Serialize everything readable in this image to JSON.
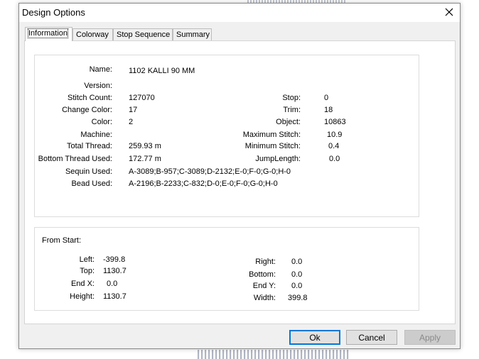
{
  "window": {
    "title": "Design Options"
  },
  "tabs": [
    {
      "label": "Information"
    },
    {
      "label": "Colorway"
    },
    {
      "label": "Stop Sequence"
    },
    {
      "label": "Summary"
    }
  ],
  "info": {
    "name_label": "Name:",
    "name_value": "1102 KALLI 90 MM",
    "version_label": "Version:",
    "version_value": "",
    "stitch_count_label": "Stitch Count:",
    "stitch_count_value": "127070",
    "change_color_label": "Change Color:",
    "change_color_value": "17",
    "color_label": "Color:",
    "color_value": "2",
    "machine_label": "Machine:",
    "machine_value": "",
    "total_thread_label": "Total Thread:",
    "total_thread_value": "259.93 m",
    "bottom_thread_label": "Bottom Thread Used:",
    "bottom_thread_value": "172.77 m",
    "sequin_label": "Sequin Used:",
    "sequin_value": "A-3089;B-957;C-3089;D-2132;E-0;F-0;G-0;H-0",
    "bead_label": "Bead Used:",
    "bead_value": "A-2196;B-2233;C-832;D-0;E-0;F-0;G-0;H-0",
    "stop_label": "Stop:",
    "stop_value": "0",
    "trim_label": "Trim:",
    "trim_value": "18",
    "object_label": "Object:",
    "object_value": "10863",
    "max_stitch_label": "Maximum Stitch:",
    "max_stitch_value": "10.9",
    "min_stitch_label": "Minimum Stitch:",
    "min_stitch_value": "0.4",
    "jump_length_label": "JumpLength:",
    "jump_length_value": "0.0"
  },
  "from_start": {
    "header": "From Start:",
    "left_label": "Left:",
    "left_value": "-399.8",
    "top_label": "Top:",
    "top_value": "1130.7",
    "endx_label": "End X:",
    "endx_value": "0.0",
    "height_label": "Height:",
    "height_value": "1130.7",
    "right_label": "Right:",
    "right_value": "0.0",
    "bottom_label": "Bottom:",
    "bottom_value": "0.0",
    "endy_label": "End Y:",
    "endy_value": "0.0",
    "width_label": "Width:",
    "width_value": "399.8"
  },
  "buttons": {
    "ok": "Ok",
    "cancel": "Cancel",
    "apply": "Apply"
  },
  "colors": {
    "accent": "#0078d7",
    "dialog_bg": "#f0f0f0",
    "panel_bg": "#ffffff"
  }
}
